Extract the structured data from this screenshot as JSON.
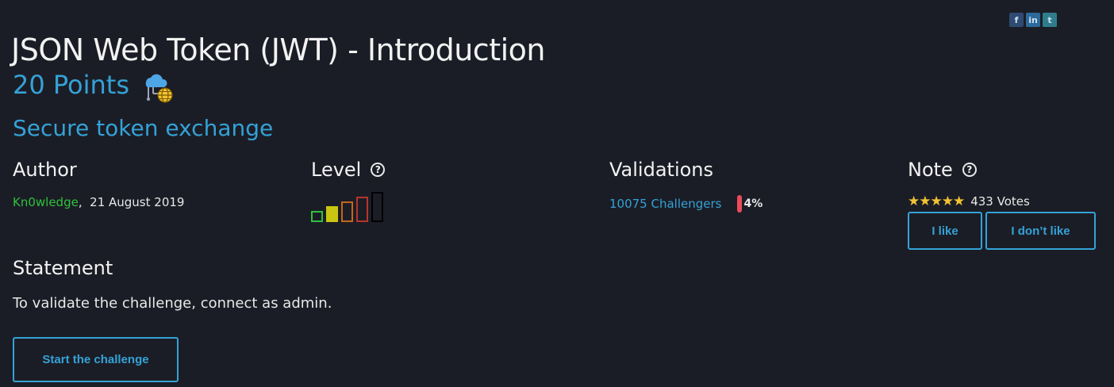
{
  "challenge": {
    "title": "JSON Web Token (JWT) - Introduction",
    "points": "20 Points",
    "category_icon": "cloud-network-globe-icon",
    "subtitle": "Secure token exchange"
  },
  "social": [
    {
      "icon": "facebook-icon",
      "label": "f"
    },
    {
      "icon": "linkedin-icon",
      "label": "in"
    },
    {
      "icon": "twitter-icon",
      "label": "t"
    }
  ],
  "author": {
    "heading": "Author",
    "name": "Kn0wledge",
    "separator": ",",
    "date": "21 August 2019"
  },
  "level": {
    "heading": "Level",
    "help": "?",
    "current_level": 1,
    "max_level": 5,
    "colors": [
      "#2fc13b",
      "#c9c612",
      "#c5661a",
      "#b8342c",
      "#000000"
    ]
  },
  "validations": {
    "heading": "Validations",
    "challengers": "10075 Challengers",
    "percent": "4%"
  },
  "note": {
    "heading": "Note",
    "help": "?",
    "stars": "★★★★★",
    "rating_stars": 5,
    "votes": "433 Votes",
    "like_label": "I like",
    "dislike_label": "I don’t like"
  },
  "statement": {
    "heading": "Statement",
    "text": "To validate the challenge, connect as admin.",
    "start_label": "Start the challenge"
  },
  "colors": {
    "background": "#1b1d26",
    "accent": "#34a2d6",
    "author": "#2fc13b",
    "percent_bar": "#ea4b5a",
    "stars": "#f1c232"
  }
}
